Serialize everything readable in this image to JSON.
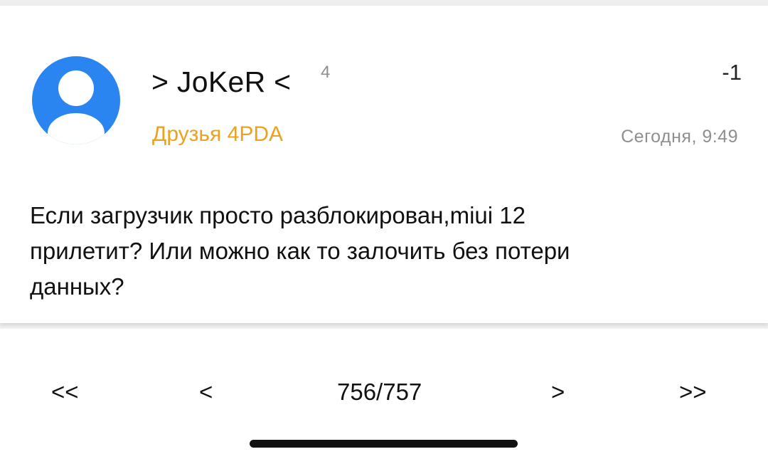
{
  "post": {
    "author": "> JoKeR <",
    "author_badge": "4",
    "group": "Друзья 4PDA",
    "rating": "-1",
    "time": "Сегодня, 9:49",
    "body": "Если загрузчик просто разблокирован,miui 12\nприлетит? Или можно как то залочить без потери\nданных?",
    "avatar_icon": "user-avatar-icon",
    "colors": {
      "avatar_bg": "#2b85f0",
      "group_text": "#eba21e"
    }
  },
  "pager": {
    "first": "<<",
    "prev": "<",
    "current": "756/757",
    "next": ">",
    "last": ">>"
  }
}
